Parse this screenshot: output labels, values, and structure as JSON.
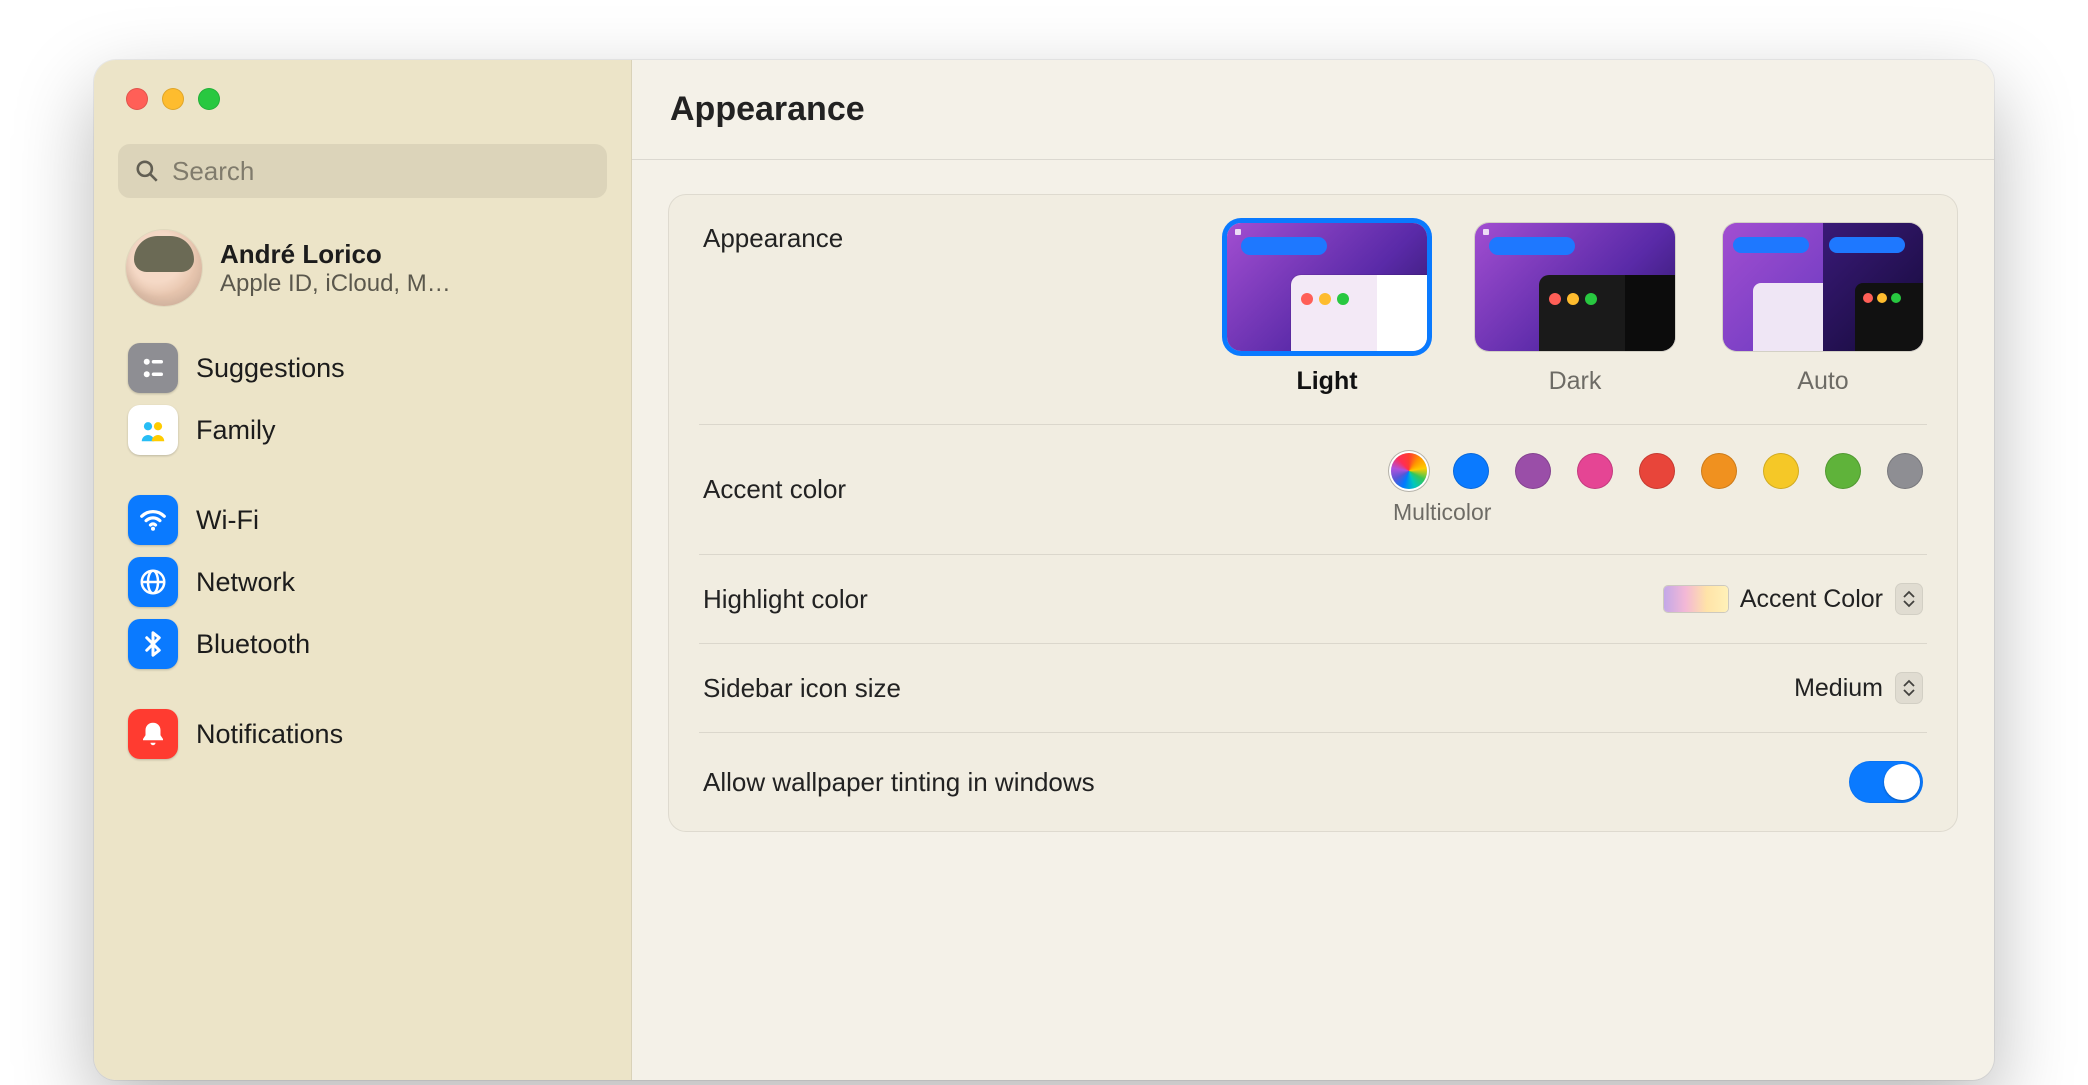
{
  "header": {
    "title": "Appearance"
  },
  "search": {
    "placeholder": "Search"
  },
  "user": {
    "name": "André Lorico",
    "sub": "Apple ID, iCloud, M…"
  },
  "sidebar": {
    "groups": [
      {
        "items": [
          {
            "label": "Suggestions",
            "icon": "suggestions",
            "bg": "#8e8e93"
          },
          {
            "label": "Family",
            "icon": "family",
            "bg": "#ffffff"
          }
        ]
      },
      {
        "items": [
          {
            "label": "Wi-Fi",
            "icon": "wifi",
            "bg": "#0a7aff"
          },
          {
            "label": "Network",
            "icon": "network",
            "bg": "#0a7aff"
          },
          {
            "label": "Bluetooth",
            "icon": "bluetooth",
            "bg": "#0a7aff"
          }
        ]
      },
      {
        "items": [
          {
            "label": "Notifications",
            "icon": "notifications",
            "bg": "#ff3b30"
          }
        ]
      }
    ]
  },
  "settings": {
    "appearance": {
      "label": "Appearance",
      "options": [
        {
          "label": "Light",
          "selected": true
        },
        {
          "label": "Dark",
          "selected": false
        },
        {
          "label": "Auto",
          "selected": false
        }
      ]
    },
    "accent": {
      "label": "Accent color",
      "selected_label": "Multicolor",
      "colors": [
        "multicolor",
        "#0a7aff",
        "#9a4ea8",
        "#e54594",
        "#e8453a",
        "#f0911f",
        "#f5c827",
        "#5fb33a",
        "#8e8e93"
      ]
    },
    "highlight": {
      "label": "Highlight color",
      "value": "Accent Color"
    },
    "sidebar_size": {
      "label": "Sidebar icon size",
      "value": "Medium"
    },
    "tint": {
      "label": "Allow wallpaper tinting in windows",
      "value": true
    }
  }
}
